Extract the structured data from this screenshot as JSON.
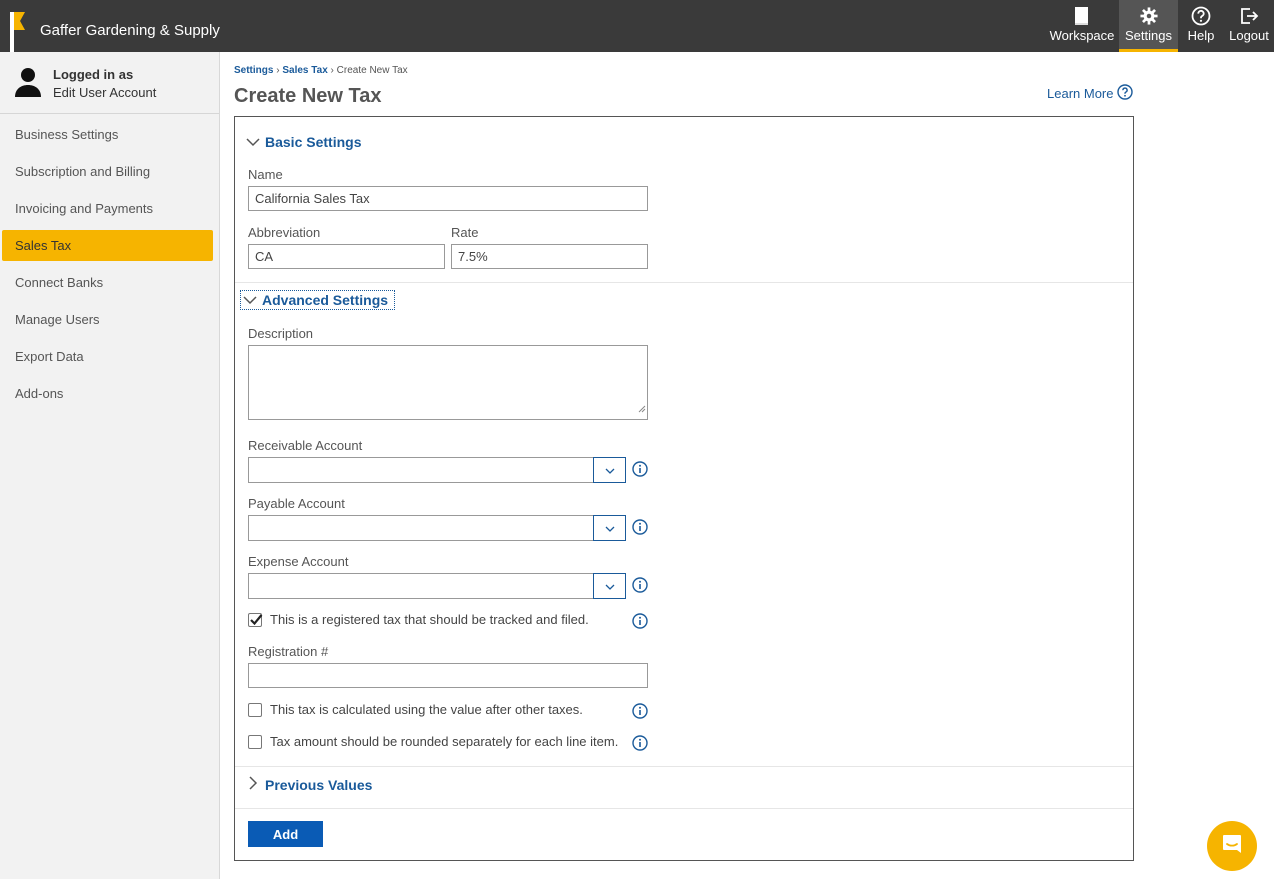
{
  "brand": {
    "name": "Gaffer Gardening & Supply"
  },
  "topnav": {
    "workspace": "Workspace",
    "settings": "Settings",
    "help": "Help",
    "logout": "Logout"
  },
  "user": {
    "logged_in": "Logged in as",
    "edit": "Edit User Account"
  },
  "sidebar": {
    "items": [
      {
        "label": "Business Settings"
      },
      {
        "label": "Subscription and Billing"
      },
      {
        "label": "Invoicing and Payments"
      },
      {
        "label": "Sales Tax"
      },
      {
        "label": "Connect Banks"
      },
      {
        "label": "Manage Users"
      },
      {
        "label": "Export Data"
      },
      {
        "label": "Add-ons"
      }
    ],
    "active": "Sales Tax"
  },
  "breadcrumb": {
    "level1": "Settings",
    "level2": "Sales Tax",
    "current": "Create New Tax",
    "sep": "›"
  },
  "page": {
    "title": "Create New Tax",
    "learn_more": "Learn More"
  },
  "basic": {
    "heading": "Basic Settings",
    "name_label": "Name",
    "name_value": "California Sales Tax",
    "abbr_label": "Abbreviation",
    "abbr_value": "CA",
    "rate_label": "Rate",
    "rate_value": "7.5%"
  },
  "advanced": {
    "heading": "Advanced Settings",
    "description_label": "Description",
    "receivable_label": "Receivable Account",
    "payable_label": "Payable Account",
    "expense_label": "Expense Account",
    "registered_label": "This is a registered tax that should be tracked and filed.",
    "registered_checked": true,
    "registration_label": "Registration #",
    "after_taxes_label": "This tax is calculated using the value after other taxes.",
    "rounded_label": "Tax amount should be rounded separately for each line item."
  },
  "previous": {
    "heading": "Previous Values"
  },
  "actions": {
    "add": "Add"
  },
  "colors": {
    "accent": "#f6b400",
    "link": "#1a5a9a",
    "primary_button": "#0a5bb5",
    "topbar": "#3a3a3a"
  }
}
